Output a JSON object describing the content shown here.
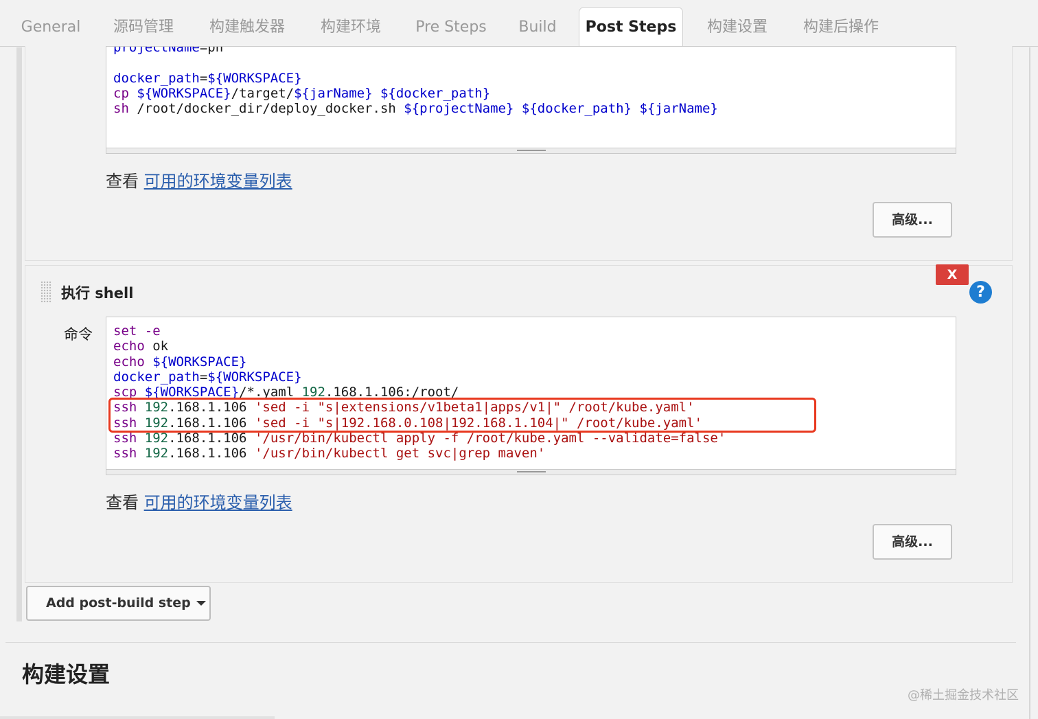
{
  "tabs": [
    {
      "label": "General",
      "active": false
    },
    {
      "label": "源码管理",
      "active": false
    },
    {
      "label": "构建触发器",
      "active": false
    },
    {
      "label": "构建环境",
      "active": false
    },
    {
      "label": "Pre Steps",
      "active": false
    },
    {
      "label": "Build",
      "active": false
    },
    {
      "label": "Post Steps",
      "active": true
    },
    {
      "label": "构建设置",
      "active": false
    },
    {
      "label": "构建后操作",
      "active": false
    }
  ],
  "step1": {
    "env_prefix": "查看",
    "env_link": "可用的环境变量列表",
    "advanced_label": "高级..."
  },
  "step2": {
    "title": "执行 shell",
    "close_label": "X",
    "help_label": "?",
    "command_label": "命令",
    "env_prefix": "查看",
    "env_link": "可用的环境变量列表",
    "advanced_label": "高级..."
  },
  "add_step_label": "Add post-build step",
  "section_heading": "构建设置",
  "watermark": "@稀土掘金技术社区",
  "colors": {
    "accent_link": "#2b5fad",
    "highlight_border": "#e8381f",
    "close_red": "#d9403a",
    "help_blue": "#1e7dd1"
  }
}
